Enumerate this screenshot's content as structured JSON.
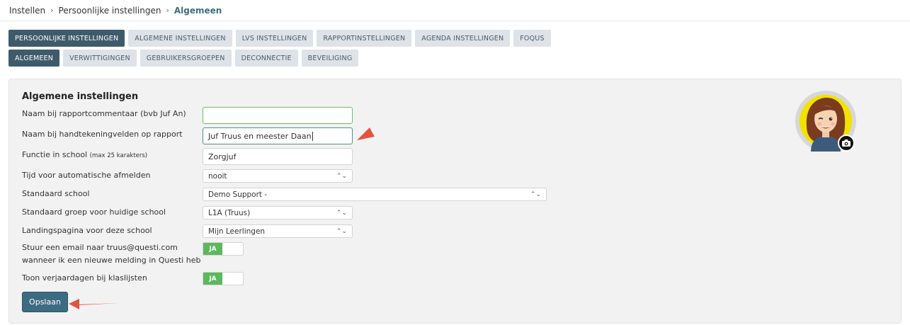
{
  "breadcrumb": {
    "items": [
      "Instellen",
      "Persoonlijke instellingen",
      "Algemeen"
    ],
    "separator": "›"
  },
  "tabs_main": [
    {
      "label": "PERSOONLIJKE INSTELLINGEN",
      "active": true
    },
    {
      "label": "ALGEMENE INSTELLINGEN",
      "active": false
    },
    {
      "label": "LVS INSTELLINGEN",
      "active": false
    },
    {
      "label": "RAPPORTINSTELLINGEN",
      "active": false
    },
    {
      "label": "AGENDA INSTELLINGEN",
      "active": false
    },
    {
      "label": "FOQUS",
      "active": false
    }
  ],
  "tabs_sub": [
    {
      "label": "ALGEMEEN",
      "active": true
    },
    {
      "label": "VERWITTIGINGEN",
      "active": false
    },
    {
      "label": "GEBRUIKERSGROEPEN",
      "active": false
    },
    {
      "label": "DECONNECTIE",
      "active": false
    },
    {
      "label": "BEVEILIGING",
      "active": false
    }
  ],
  "panel": {
    "title": "Algemene instellingen",
    "fields": {
      "rapportcommentaar": {
        "label": "Naam bij rapportcommentaar (bvb Juf An)",
        "value": ""
      },
      "handtekening": {
        "label": "Naam bij handtekeningvelden op rapport",
        "value": "Juf Truus en meester Daan"
      },
      "functie": {
        "label": "Functie in school",
        "hint": "(max 25 karakters)",
        "value": "Zorgjuf"
      },
      "afmelden": {
        "label": "Tijd voor automatische afmelden",
        "value": "nooit"
      },
      "school": {
        "label": "Standaard school",
        "value": "Demo Support -"
      },
      "groep": {
        "label": "Standaard groep voor huidige school",
        "value": "L1A (Truus)"
      },
      "landing": {
        "label": "Landingspagina voor deze school",
        "value": "Mijn Leerlingen"
      },
      "email": {
        "label_line1": "Stuur een email naar truus@questi.com",
        "label_line2": "wanneer ik een nieuwe melding in Questi heb",
        "toggle": "JA"
      },
      "verjaardagen": {
        "label": "Toon verjaardagen bij klaslijsten",
        "toggle": "JA"
      }
    },
    "save_label": "Opslaan"
  },
  "icons": {
    "select_chevron": "⌃⌄",
    "camera": "camera-icon",
    "avatar": "avatar-illustration"
  },
  "colors": {
    "tab_active": "#3e5b6b",
    "tab_inactive": "#dde3e8",
    "toggle_on": "#5cb85c",
    "save_button": "#3d6b82",
    "breadcrumb_current": "#3f6f78",
    "annotation_arrow": "#e2533f"
  }
}
